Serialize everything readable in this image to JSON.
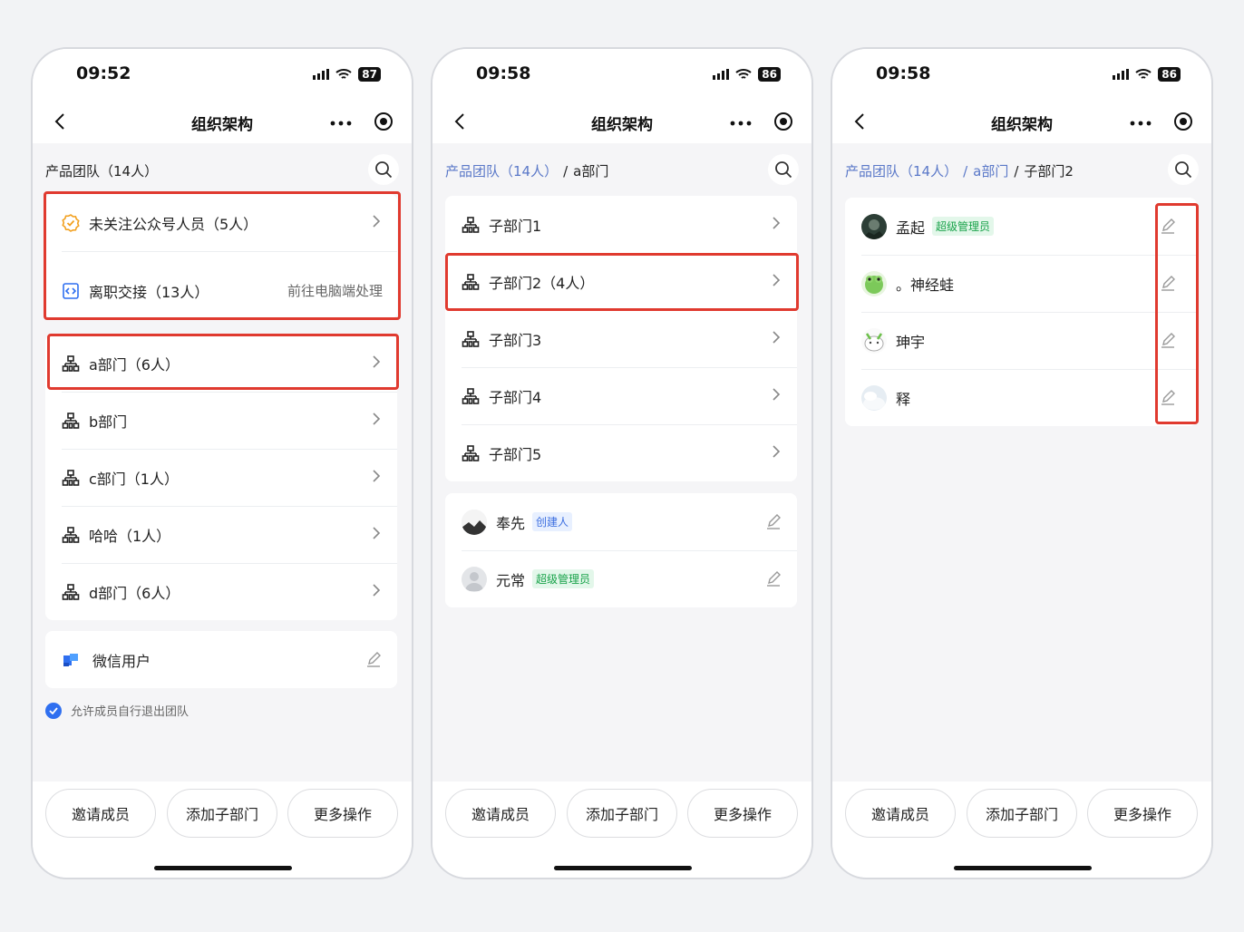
{
  "colors": {
    "accent": "#2f6ff0",
    "highlight": "#e03a2f",
    "link": "#5a78c8",
    "admin_badge": "#19a34a",
    "creator_badge": "#3d6fe0"
  },
  "icons": {
    "back": "chevron-left-icon",
    "menu": "more-dots-icon",
    "capsule": "target-circle-icon",
    "search": "search-icon",
    "dept": "org-tree-icon",
    "chevron": "chevron-right-icon",
    "edit": "edit-pencil-icon"
  },
  "screens": [
    {
      "time": "09:52",
      "battery": "87",
      "title": "组织架构",
      "breadcrumb": [
        "产品团队（14人）"
      ],
      "special": [
        {
          "label": "未关注公众号人员（5人）"
        },
        {
          "label": "离职交接（13人）",
          "action": "前往电脑端处理"
        }
      ],
      "departments": [
        "a部门（6人）",
        "b部门",
        "c部门（1人）",
        "哈哈（1人）",
        "d部门（6人）"
      ],
      "wechat": "微信用户",
      "allow_exit": "允许成员自行退出团队",
      "buttons": [
        "邀请成员",
        "添加子部门",
        "更多操作"
      ]
    },
    {
      "time": "09:58",
      "battery": "86",
      "title": "组织架构",
      "breadcrumb": [
        "产品团队（14人）",
        "/",
        "a部门"
      ],
      "departments": [
        "子部门1",
        "子部门2（4人）",
        "子部门3",
        "子部门4",
        "子部门5"
      ],
      "members": [
        {
          "name": "奉先",
          "badge": "创建人"
        },
        {
          "name": "元常",
          "badge": "超级管理员"
        }
      ],
      "buttons": [
        "邀请成员",
        "添加子部门",
        "更多操作"
      ]
    },
    {
      "time": "09:58",
      "battery": "86",
      "title": "组织架构",
      "breadcrumb": [
        "产品团队（14人）",
        "/",
        "a部门",
        "/",
        "子部门2"
      ],
      "members": [
        {
          "name": "孟起",
          "badge": "超级管理员"
        },
        {
          "name": "。神经蛙"
        },
        {
          "name": "珅宇"
        },
        {
          "name": "释"
        }
      ],
      "buttons": [
        "邀请成员",
        "添加子部门",
        "更多操作"
      ]
    }
  ]
}
